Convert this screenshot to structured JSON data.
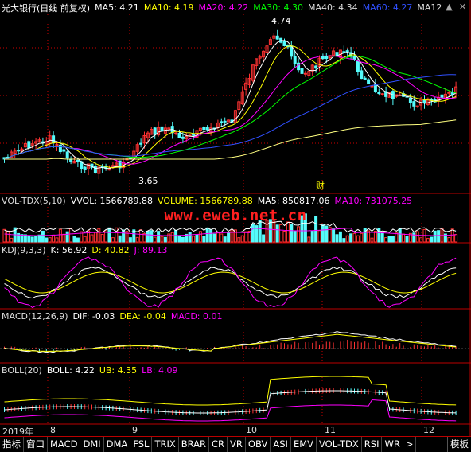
{
  "main_header": {
    "stock_title": "光大银行(日线 前复权)",
    "ma5": "MA5: 4.21",
    "ma10": "MA10: 4.19",
    "ma20": "MA20: 4.22",
    "ma30": "MA30: 4.30",
    "ma40": "MA40: 4.34",
    "ma60": "MA60: 4.27",
    "ma12x": "MA12",
    "high_label": "4.74",
    "low_label": "3.65",
    "cai_label": "财"
  },
  "vol_header": {
    "name": "VOL-TDX(5,10)",
    "vvol": "VVOL: 1566789.88",
    "volume": "VOLUME: 1566789.88",
    "ma5": "MA5: 850817.06",
    "ma10": "MA10: 731075.25"
  },
  "kdj_header": {
    "name": "KDJ(9,3,3)",
    "k": "K: 56.92",
    "d": "D: 40.82",
    "j": "J: 89.13"
  },
  "macd_header": {
    "name": "MACD(12,26,9)",
    "dif": "DIF: -0.03",
    "dea": "DEA: -0.04",
    "macd": "MACD: 0.01"
  },
  "boll_header": {
    "name": "BOLL(20)",
    "boll": "BOLL: 4.22",
    "ub": "UB: 4.35",
    "lb": "LB: 4.09"
  },
  "watermark": "www.eweb.net.cn",
  "date_axis": [
    "2019年",
    "8",
    "9",
    "10",
    "11",
    "12"
  ],
  "tabs": [
    "指标",
    "窗口",
    "MACD",
    "DMI",
    "DMA",
    "FSL",
    "TRIX",
    "BRAR",
    "CR",
    "VR",
    "OBV",
    "ASI",
    "EMV",
    "VOL-TDX",
    "RSI",
    "WR",
    ">"
  ],
  "template_tab": "模板",
  "colors": {
    "up": "#ff3232",
    "down": "#54fcfc",
    "ma5": "#ffffff",
    "ma10": "#ffff00",
    "ma20": "#ff00ff",
    "ma30": "#00ff00",
    "ma40": "#ffffff",
    "ma60": "#3050ff",
    "ma12x": "#ffff80"
  }
}
